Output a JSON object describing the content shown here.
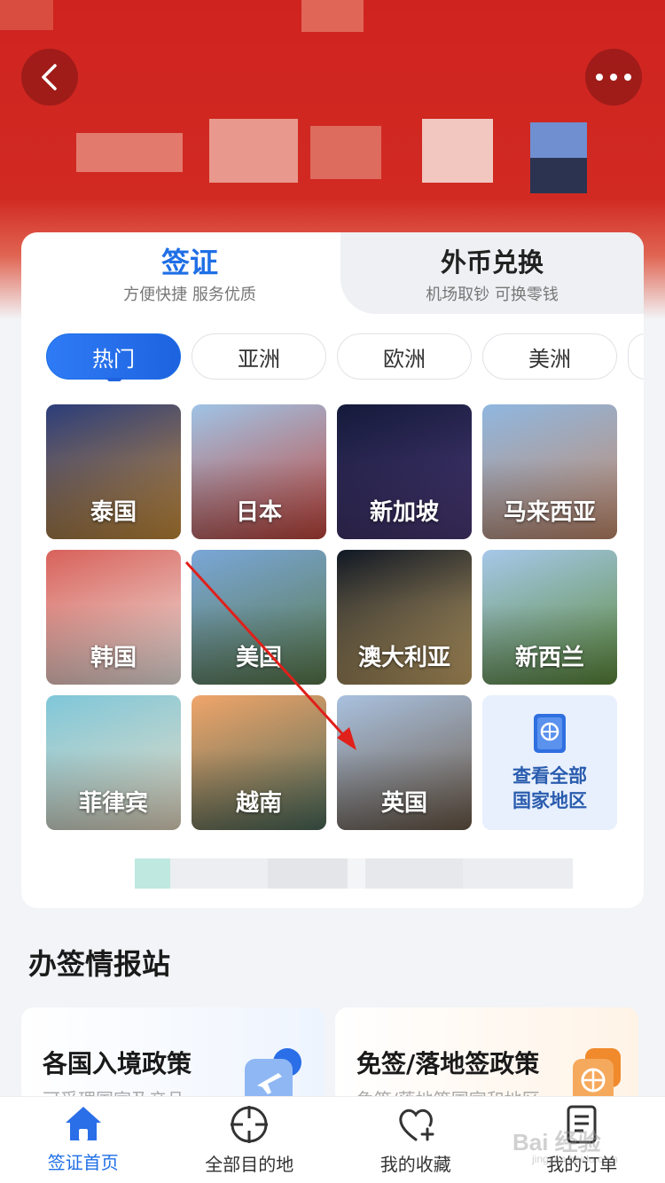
{
  "header": {
    "back_icon": "chevron-left-icon",
    "more_icon": "more-dots-icon"
  },
  "tabs": [
    {
      "title": "签证",
      "subtitle": "方便快捷 服务优质",
      "active": true
    },
    {
      "title": "外币兑换",
      "subtitle": "机场取钞 可换零钱",
      "active": false
    }
  ],
  "regions": [
    "热门",
    "亚洲",
    "欧洲",
    "美洲"
  ],
  "countries": [
    {
      "name": "泰国",
      "colors": [
        "#2b3d7a",
        "#c98e3a"
      ]
    },
    {
      "name": "日本",
      "colors": [
        "#9fc4e6",
        "#c2453a"
      ]
    },
    {
      "name": "新加坡",
      "colors": [
        "#141a3a",
        "#4c3a78"
      ]
    },
    {
      "name": "马来西亚",
      "colors": [
        "#8fb7e0",
        "#c48a6a"
      ]
    },
    {
      "name": "韩国",
      "colors": [
        "#d8615a",
        "#f1e9e4"
      ]
    },
    {
      "name": "美国",
      "colors": [
        "#7aa6d8",
        "#5a7a4a"
      ]
    },
    {
      "name": "澳大利亚",
      "colors": [
        "#101824",
        "#c9a86a"
      ]
    },
    {
      "name": "新西兰",
      "colors": [
        "#a6c8ea",
        "#5c8a3a"
      ]
    },
    {
      "name": "菲律宾",
      "colors": [
        "#7fc7d9",
        "#e9dcc4"
      ]
    },
    {
      "name": "越南",
      "colors": [
        "#f0a56a",
        "#4a6a5a"
      ]
    },
    {
      "name": "英国",
      "colors": [
        "#a9c1df",
        "#6c5a48"
      ]
    }
  ],
  "view_all": {
    "label": "查看全部国家地区",
    "icon": "passport-icon"
  },
  "section": {
    "title": "办签情报站"
  },
  "info_cards": [
    {
      "title": "各国入境政策",
      "subtitle": "可受理国家及产品",
      "icon": "airplane-badge-icon"
    },
    {
      "title": "免签/落地签政策",
      "subtitle": "免签/落地签国家和地区",
      "icon": "globe-badge-icon"
    }
  ],
  "bottom_nav": [
    {
      "label": "签证首页",
      "icon": "home-icon",
      "active": true
    },
    {
      "label": "全部目的地",
      "icon": "crosshair-icon",
      "active": false
    },
    {
      "label": "我的收藏",
      "icon": "heart-plus-icon",
      "active": false
    },
    {
      "label": "我的订单",
      "icon": "order-list-icon",
      "active": false
    }
  ],
  "watermark": {
    "text": "Bai 经验",
    "sub": "jingyan.baidu.com"
  },
  "colors": {
    "brand_red": "#cf2320",
    "accent_blue": "#1f6fe6",
    "annotation_red": "#e0201a"
  }
}
